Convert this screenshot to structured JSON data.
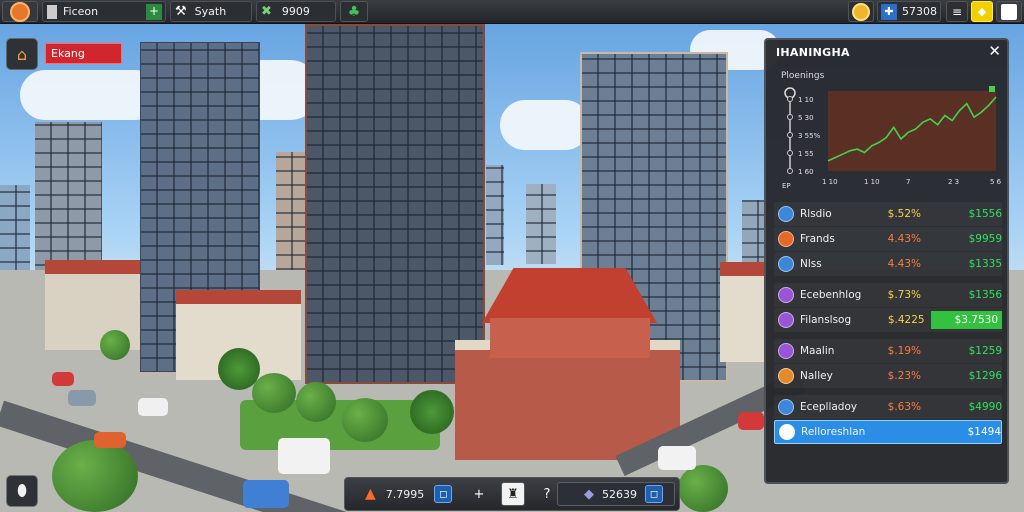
{
  "topbar": {
    "player_name": "Ficeon",
    "add_label": "+",
    "stat_1": "Syath",
    "stat_2": "9909",
    "money": "57308",
    "menu_icon": "≡"
  },
  "alert": {
    "label": "Ekang"
  },
  "panel": {
    "title": "IHANINGHA",
    "close": "✕",
    "chart_subtitle": "Ploenings",
    "chart_data": {
      "type": "line",
      "title": "",
      "y_tick_labels": [
        "1 10",
        "5 30",
        "3 55%",
        "1 55",
        "1 60"
      ],
      "x_tick_labels": [
        "1 10",
        "1 10",
        "7",
        "2 3",
        "5 6"
      ],
      "x_axis_label": "EP",
      "series": [
        {
          "values": [
            12,
            16,
            20,
            24,
            26,
            22,
            30,
            34,
            40,
            52,
            38,
            46,
            50,
            58,
            62,
            55,
            66,
            60,
            72,
            80,
            64,
            70,
            78,
            88
          ]
        }
      ]
    },
    "rows": [
      {
        "name": "Rlsdio",
        "pct": "$.52%",
        "val": "$1556",
        "pct_color": "#f4d248",
        "icon_color": "#3d86d9"
      },
      {
        "name": "Frands",
        "pct": "4.43%",
        "val": "$9959",
        "pct_color": "#ff7a3d",
        "icon_color": "#e56a2a"
      },
      {
        "name": "Nlss",
        "pct": "4.43%",
        "val": "$1335",
        "pct_color": "#ff7a3d",
        "icon_color": "#3d86d9"
      },
      {
        "name": "Ecebenhlog",
        "pct": "$.73%",
        "val": "$1356",
        "pct_color": "#f4d248",
        "icon_color": "#9a55d6"
      },
      {
        "name": "Filanslsog",
        "pct": "$.4225",
        "val": "$3.7530",
        "pct_color": "#f4d248",
        "icon_color": "#9a55d6",
        "highlight": "green"
      },
      {
        "name": "Maalin",
        "pct": "$.19%",
        "val": "$1259",
        "pct_color": "#ff7a3d",
        "icon_color": "#9a55d6"
      },
      {
        "name": "Nalley",
        "pct": "$.23%",
        "val": "$1296",
        "pct_color": "#ff7a3d",
        "icon_color": "#e58a2a"
      },
      {
        "name": "Eceplladoy",
        "pct": "$.63%",
        "val": "$4990",
        "pct_color": "#ff7a3d",
        "icon_color": "#3d86d9"
      },
      {
        "name": "Relloreshlan",
        "pct": "",
        "val": "$1494",
        "pct_color": "#ffffff",
        "icon_color": "#ffffff",
        "highlight": "blue"
      }
    ]
  },
  "bottombar": {
    "value_1": "7.7995",
    "plus": "+",
    "question": "?",
    "value_2": "52639"
  },
  "colors": {
    "accent_green": "#2fe35a",
    "accent_blue": "#2a8ee6",
    "alert_red": "#d2262e"
  }
}
